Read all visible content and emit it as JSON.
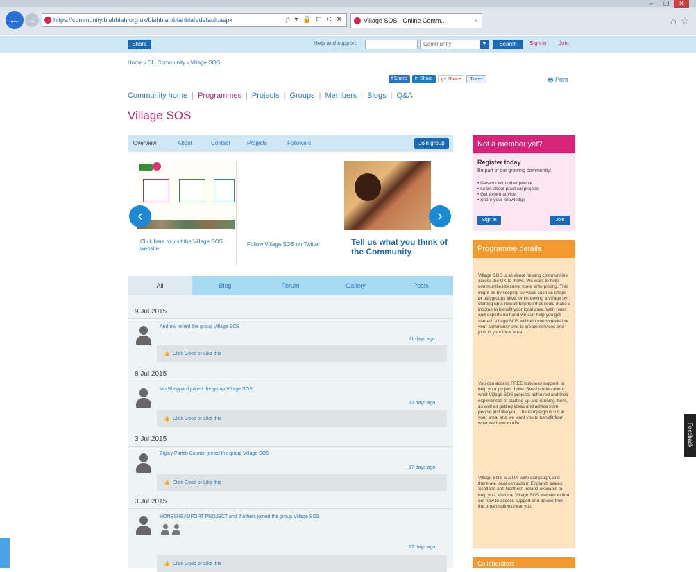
{
  "browser": {
    "url": "https://community.blahblah.org.uk/blahblah/blahblah/default.aspx",
    "tab_title": "Village SOS - Online Comm...",
    "window_controls": [
      "–",
      "❐",
      "✕"
    ],
    "back_icon": "←",
    "forward_icon": "→",
    "addr_tools": "ρ ▾ 🔒 ⊡ C ✕",
    "tab_close": "×",
    "home_icon": "⌂",
    "star_icon": "☆"
  },
  "sitebar": {
    "share_label": "Share",
    "help_text": "Help and support",
    "search_placeholder": "",
    "scope_value": "Community",
    "scope_arrow": "▼",
    "search_label": "Search",
    "signin_label": "Sign in",
    "join_label": "Join"
  },
  "breadcrumb": "Home  ›  OU Community  ›  Village SOS",
  "social": {
    "share": "f Share",
    "linkedin": "in Share",
    "gplus": "g+ Share",
    "tweet": "Tweet",
    "print": "Print",
    "print_icon": "🖶"
  },
  "mainnav": {
    "items": [
      "Community home",
      "Programmes",
      "Projects",
      "Groups",
      "Members",
      "Blogs",
      "Q&A"
    ],
    "separator": "|"
  },
  "page_title": "Village SOS",
  "group_tabs": {
    "items": [
      "Overview",
      "About",
      "Contact",
      "Projects",
      "Followers"
    ],
    "join_group": "Join group"
  },
  "carousel": {
    "slide1_caption": "Click here to visit the Village SOS website",
    "slide2_caption": "Follow Village SOS on Twitter",
    "slide3_caption": "Tell us what you think of the Community",
    "prev_icon": "‹",
    "next_icon": "›"
  },
  "activity_tabs": [
    "All",
    "Blog",
    "Forum",
    "Gallery",
    "Posts"
  ],
  "feed": [
    {
      "date": "9 Jul 2015",
      "post": "Andrew joined the group Village SOS",
      "ago": "11 days ago",
      "like": "Click Good or Like this"
    },
    {
      "date": "8 Jul 2015",
      "post": "Ian Sheppard joined the group Village SOS",
      "ago": "12 days ago",
      "like": "Click Good or Like this"
    },
    {
      "date": "3 Jul 2015",
      "post": "Bigley Parish Council joined the group Village SOS",
      "ago": "17 days ago",
      "like": "Click Good or Like this"
    },
    {
      "date": "3 Jul 2015",
      "post": "HONESHEADPORT PROJECT and 2 others joined the group Village SOS",
      "ago": "17 days ago",
      "like": "Click Good or Like this"
    }
  ],
  "like_icon": "👍",
  "member_box": {
    "title": "Not a member yet?",
    "register_title": "Register today",
    "intro": "Be part of our growing community:",
    "benefits": [
      "Network with other people",
      "Learn about practical projects",
      "Get expert advice",
      "Share your knowledge"
    ],
    "signin": "Sign in",
    "join": "Join"
  },
  "programme_box": {
    "title": "Programme details",
    "p1": "Village SOS is all about helping communities across the UK to thrive. We want to help communities become more enterprising. This might be by keeping services such as shops or playgroups alive, or improving a village by starting up a new enterprise that could make a income to benefit your local area. With news and experts on hand we can help you get started. Village SOS will help you to revitalise your community and to create services and jobs in your local area.",
    "p2": "You can access FREE business support, to help your project thrive. Read stories about what Village SOS projects achieved and their experiences of starting up and running them, as well as getting ideas and advice from people just like you. The campaign is run in your area, and we want you to benefit from what we have to offer.",
    "p3": "Village SOS is a UK-wide campaign, and there are local contacts in England, Wales, Scotland and Northern Ireland available to help you. Visit the Village SOS website to find out how to access support and advice from the organisations near you."
  },
  "collaborators_title": "Collaborators",
  "feedback_label": "Feedback",
  "colors": {
    "brand_pink": "#c8226b",
    "link_blue": "#2b7bb9",
    "button_blue": "#1b6ab3",
    "orange": "#f29a2e"
  }
}
